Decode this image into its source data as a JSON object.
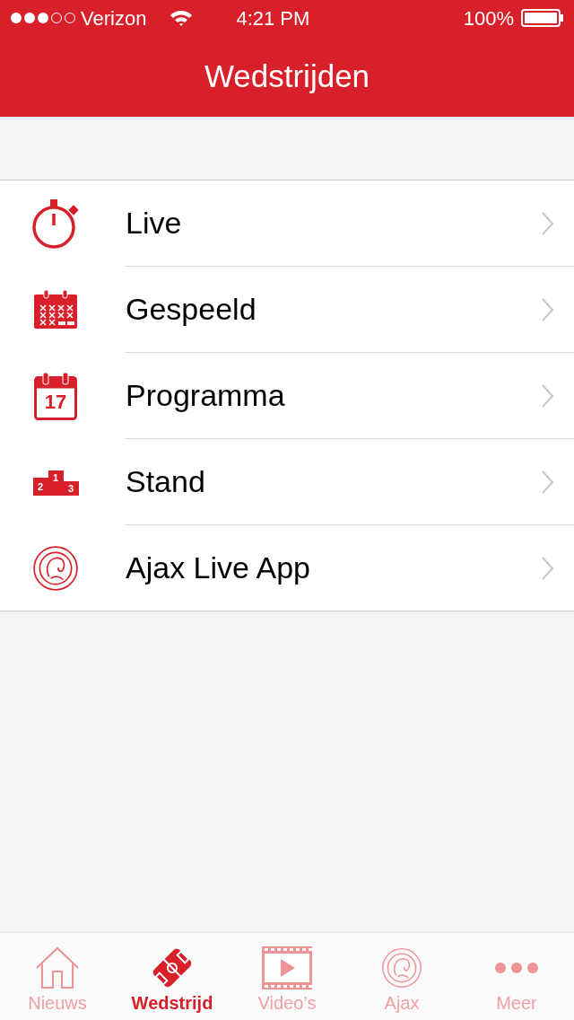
{
  "status_bar": {
    "carrier": "Verizon",
    "time": "4:21 PM",
    "battery": "100%"
  },
  "nav": {
    "title": "Wedstrijden"
  },
  "menu": [
    {
      "kind": "stopwatch",
      "label": "Live"
    },
    {
      "kind": "results",
      "label": "Gespeeld"
    },
    {
      "kind": "calendar",
      "label": "Programma",
      "day": "17"
    },
    {
      "kind": "podium",
      "label": "Stand",
      "places": [
        "2",
        "1",
        "3"
      ]
    },
    {
      "kind": "emblem",
      "label": "Ajax Live App"
    }
  ],
  "tabs": [
    {
      "kind": "house",
      "label": "Nieuws",
      "selected": false
    },
    {
      "kind": "pitch",
      "label": "Wedstrijd",
      "selected": true
    },
    {
      "kind": "film",
      "label": "Video’s",
      "selected": false
    },
    {
      "kind": "emblem",
      "label": "Ajax",
      "selected": false
    },
    {
      "kind": "dots",
      "label": "Meer",
      "selected": false
    }
  ]
}
